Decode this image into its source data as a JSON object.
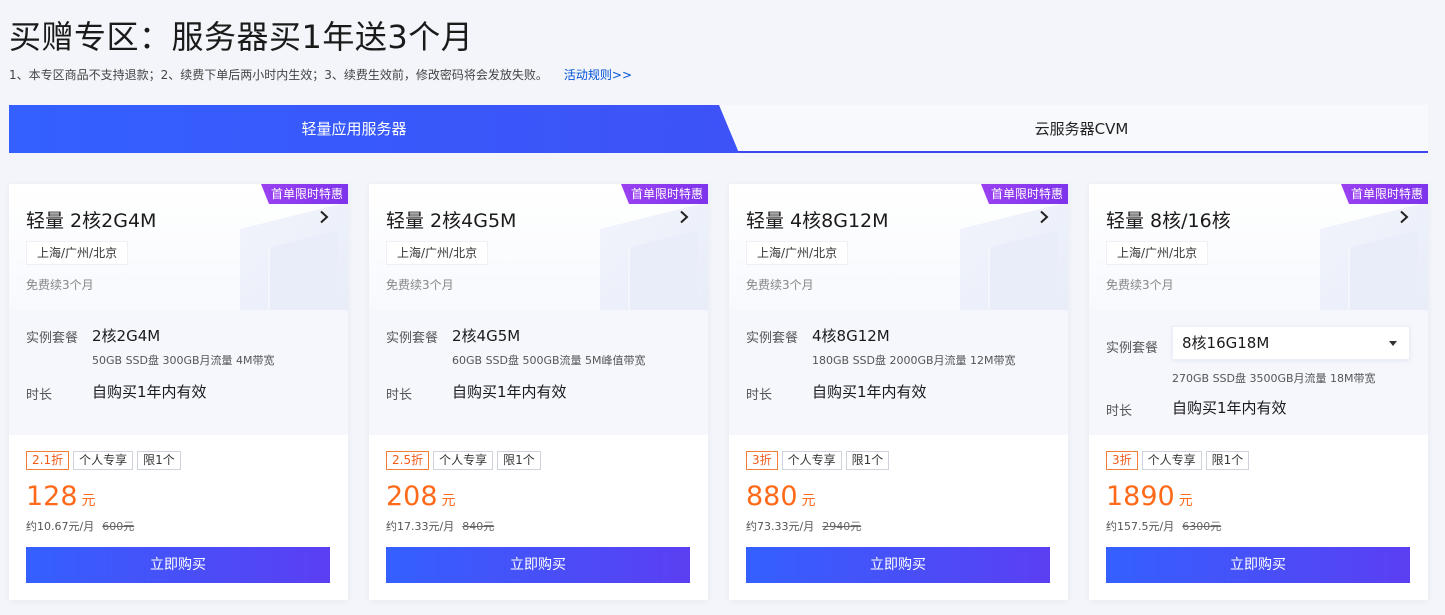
{
  "page": {
    "title": "买赠专区：服务器买1年送3个月",
    "notice": "1、本专区商品不支持退款；2、续费下单后两小时内生效；3、续费生效前，修改密码将会发放失败。",
    "rules_link": "活动规则>>"
  },
  "tabs": [
    {
      "label": "轻量应用服务器",
      "active": true
    },
    {
      "label": "云服务器CVM",
      "active": false
    }
  ],
  "cards": [
    {
      "promo_badge": "首单限时特惠",
      "title": "轻量 2核2G4M",
      "region": "上海/广州/北京",
      "renew": "免费续3个月",
      "package_label": "实例套餐",
      "package_value": "2核2G4M",
      "package_desc": "50GB SSD盘 300GB月流量 4M带宽",
      "duration_label": "时长",
      "duration_value": "自购买1年内有效",
      "discount": "2.1折",
      "tag_personal": "个人专享",
      "tag_limit": "限1个",
      "price": "128",
      "price_unit": "元",
      "per_month": "约10.67元/月",
      "original_price": "600元",
      "buy_label": "立即购买"
    },
    {
      "promo_badge": "首单限时特惠",
      "title": "轻量 2核4G5M",
      "region": "上海/广州/北京",
      "renew": "免费续3个月",
      "package_label": "实例套餐",
      "package_value": "2核4G5M",
      "package_desc": "60GB SSD盘 500GB流量 5M峰值带宽",
      "duration_label": "时长",
      "duration_value": "自购买1年内有效",
      "discount": "2.5折",
      "tag_personal": "个人专享",
      "tag_limit": "限1个",
      "price": "208",
      "price_unit": "元",
      "per_month": "约17.33元/月",
      "original_price": "840元",
      "buy_label": "立即购买"
    },
    {
      "promo_badge": "首单限时特惠",
      "title": "轻量 4核8G12M",
      "region": "上海/广州/北京",
      "renew": "免费续3个月",
      "package_label": "实例套餐",
      "package_value": "4核8G12M",
      "package_desc": "180GB SSD盘 2000GB月流量 12M带宽",
      "duration_label": "时长",
      "duration_value": "自购买1年内有效",
      "discount": "3折",
      "tag_personal": "个人专享",
      "tag_limit": "限1个",
      "price": "880",
      "price_unit": "元",
      "per_month": "约73.33元/月",
      "original_price": "2940元",
      "buy_label": "立即购买"
    },
    {
      "promo_badge": "首单限时特惠",
      "title": "轻量 8核/16核",
      "region": "上海/广州/北京",
      "renew": "免费续3个月",
      "package_label": "实例套餐",
      "package_value": "8核16G18M",
      "package_desc": "270GB SSD盘 3500GB月流量 18M带宽",
      "duration_label": "时长",
      "duration_value": "自购买1年内有效",
      "discount": "3折",
      "tag_personal": "个人专享",
      "tag_limit": "限1个",
      "price": "1890",
      "price_unit": "元",
      "per_month": "约157.5元/月",
      "original_price": "6300元",
      "buy_label": "立即购买"
    }
  ],
  "colors": {
    "accent": "#3d52f7",
    "price": "#ff6a1a",
    "badge": "#8a3af0"
  }
}
